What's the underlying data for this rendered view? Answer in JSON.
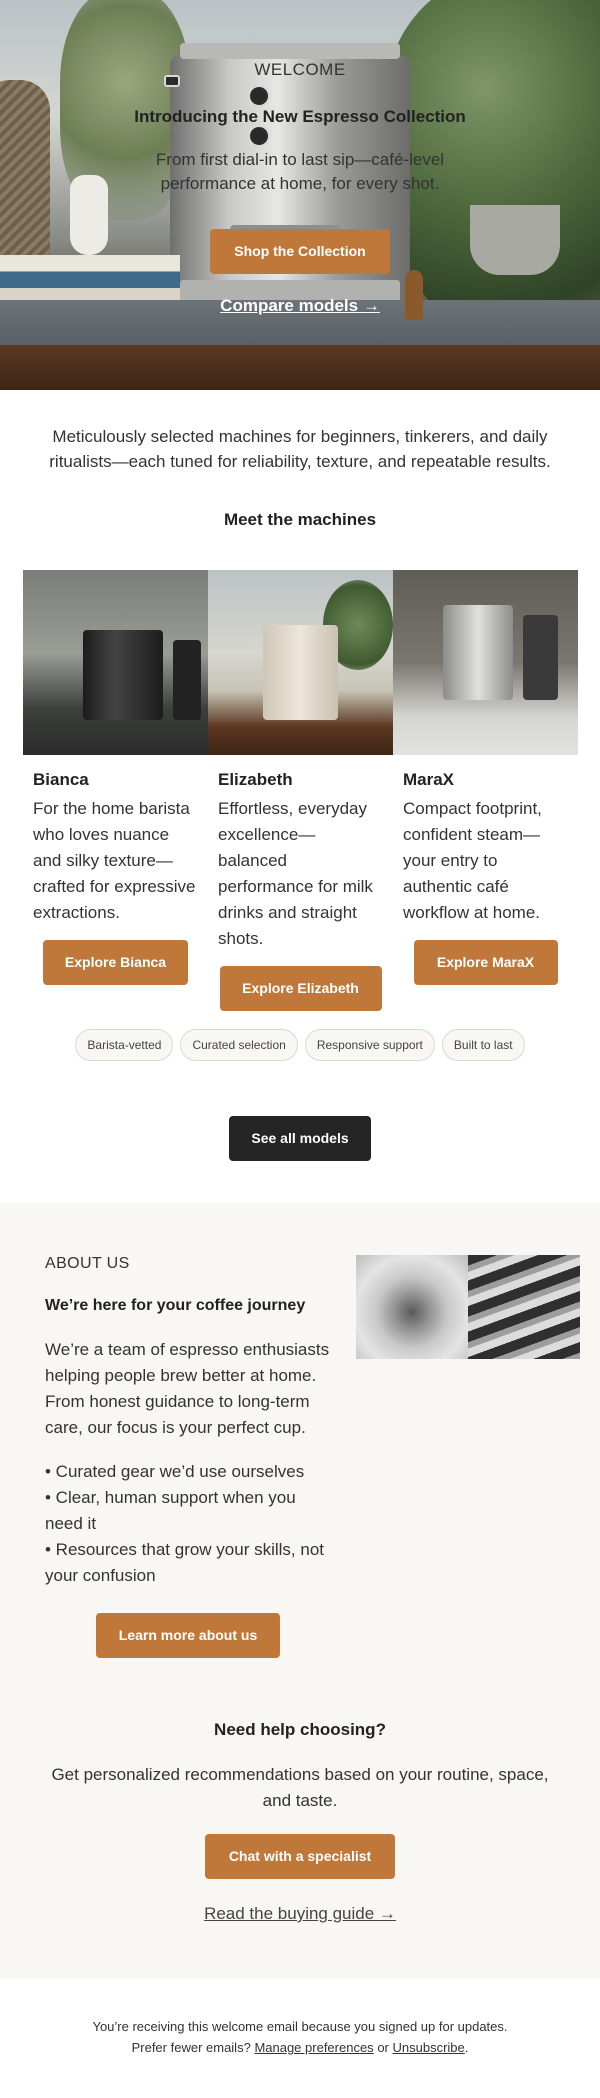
{
  "hero": {
    "eyebrow": "WELCOME",
    "title": "Introducing the New Espresso Collection",
    "subtitle": "From first dial-in to last sip—café-level performance at home, for every shot.",
    "cta": "Shop the Collection",
    "link": "Compare models →"
  },
  "intro": {
    "text": "Meticulously selected machines for beginners, tinkerers, and daily ritualists—each tuned for reliability, texture, and repeatable results."
  },
  "machines": {
    "title": "Meet the machines",
    "items": [
      {
        "name": "Bianca",
        "description": "For the home barista who loves nuance and silky texture—crafted for expressive extractions.",
        "cta": "Explore Bianca"
      },
      {
        "name": "Elizabeth",
        "description": "Effortless, everyday excellence—balanced performance for milk drinks and straight shots.",
        "cta": "Explore Elizabeth"
      },
      {
        "name": "MaraX",
        "description": "Compact footprint, confident steam—your entry to authentic café workflow at home.",
        "cta": "Explore MaraX"
      }
    ],
    "tags": [
      "Barista-vetted",
      "Curated selection",
      "Responsive support",
      "Built to last"
    ],
    "see_all": "See all models"
  },
  "about": {
    "eyebrow": "ABOUT US",
    "title": "We’re here for your coffee journey",
    "body": "We’re a team of espresso enthusiasts helping people brew better at home. From honest guidance to long-term care, our focus is your perfect cup.",
    "bullets": [
      "• Curated gear we’d use ourselves",
      "• Clear, human support when you need it",
      "• Resources that grow your skills, not your confusion"
    ],
    "cta": "Learn more about us"
  },
  "help": {
    "title": "Need help choosing?",
    "body": "Get personalized recommendations based on your routine, space, and taste.",
    "cta": "Chat with a specialist",
    "link": "Read the buying guide →"
  },
  "footer": {
    "line1": "You’re receiving this welcome email because you signed up for updates.",
    "prefix": "Prefer fewer emails?",
    "manage": "Manage preferences",
    "or": "or",
    "unsubscribe": "Unsubscribe",
    "period": "."
  },
  "colors": {
    "accent": "#c0783a",
    "dark_button": "#252525",
    "section_bg": "#f8f7f3"
  }
}
